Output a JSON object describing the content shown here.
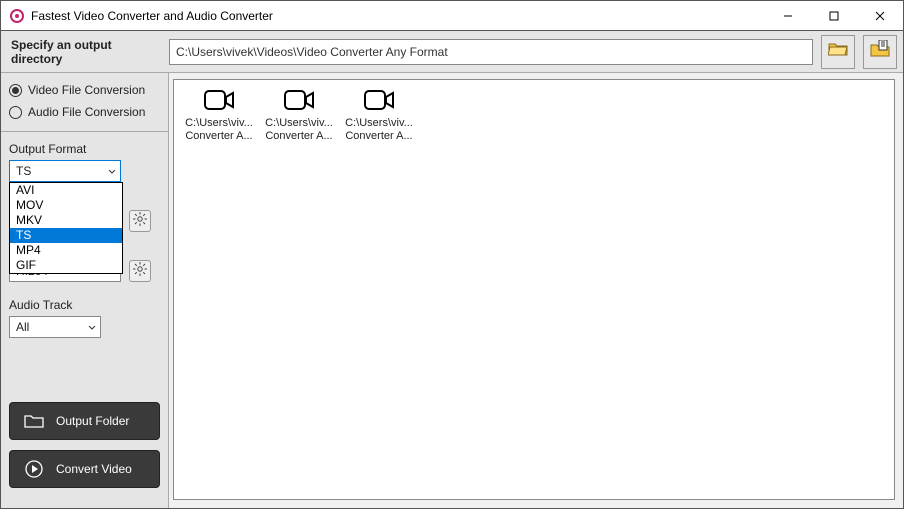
{
  "window": {
    "title": "Fastest Video Converter and Audio Converter"
  },
  "topbar": {
    "label": "Specify an output directory",
    "path": "C:\\Users\\vivek\\Videos\\Video Converter Any Format"
  },
  "sidebar": {
    "radio_video": "Video File Conversion",
    "radio_audio": "Audio File Conversion",
    "output_format_label": "Output Format",
    "output_format_value": "TS",
    "output_format_options": {
      "o0": "AVI",
      "o1": "MOV",
      "o2": "MKV",
      "o3": "TS",
      "o4": "MP4",
      "o5": "GIF"
    },
    "codec_value": "H.264",
    "audio_track_label": "Audio Track",
    "audio_track_value": "All",
    "output_folder_btn": "Output Folder",
    "convert_btn": "Convert Video"
  },
  "files": {
    "f0": {
      "line1": "C:\\Users\\viv...",
      "line2": "Converter A..."
    },
    "f1": {
      "line1": "C:\\Users\\viv...",
      "line2": "Converter A..."
    },
    "f2": {
      "line1": "C:\\Users\\viv...",
      "line2": "Converter A..."
    }
  }
}
